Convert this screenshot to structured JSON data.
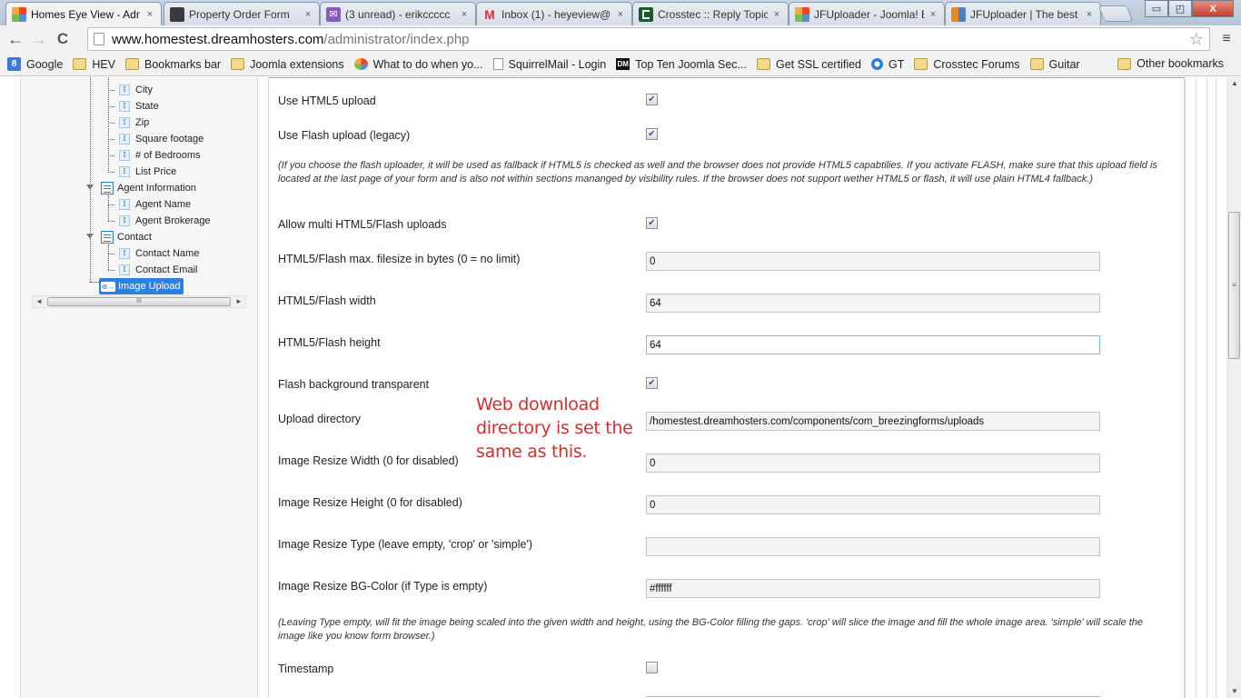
{
  "browser": {
    "tabs": [
      {
        "title": "Homes Eye View - Adr",
        "icon": "joomla-icon",
        "active": true
      },
      {
        "title": "Property Order Form",
        "icon": "joomla-dark-icon",
        "active": false
      },
      {
        "title": "(3 unread) - erikccccc",
        "icon": "mail-icon",
        "active": false
      },
      {
        "title": "Inbox (1) - heyeview@",
        "icon": "gmail-icon",
        "active": false
      },
      {
        "title": "Crosstec :: Reply Topic",
        "icon": "crosstec-icon",
        "active": false
      },
      {
        "title": "JFUploader - Joomla! E",
        "icon": "joomla-icon",
        "active": false
      },
      {
        "title": "JFUploader | The best",
        "icon": "jfuploader-icon",
        "active": false
      }
    ],
    "close_glyph": "×",
    "window_controls": {
      "minimize": "▭",
      "maximize": "◰",
      "close": "X"
    },
    "nav": {
      "back": "←",
      "forward": "→",
      "reload": "C"
    },
    "url": {
      "host": "www.homestest.dreamhosters.com",
      "path": "/administrator/index.php"
    },
    "star_glyph": "☆",
    "menu_glyph": "≡",
    "bookmarks": [
      {
        "label": "Google",
        "icon": "google-icon",
        "glyph": "8"
      },
      {
        "label": "HEV",
        "icon": "folder-icon",
        "glyph": ""
      },
      {
        "label": "Bookmarks bar",
        "icon": "folder-icon",
        "glyph": ""
      },
      {
        "label": "Joomla extensions",
        "icon": "folder-icon",
        "glyph": ""
      },
      {
        "label": "What to do when yo...",
        "icon": "joomla-icon",
        "glyph": ""
      },
      {
        "label": "SquirrelMail - Login",
        "icon": "doc-icon",
        "glyph": ""
      },
      {
        "label": "Top Ten Joomla Sec...",
        "icon": "dm-icon",
        "glyph": "DM"
      },
      {
        "label": "Get SSL certified",
        "icon": "folder-icon",
        "glyph": ""
      },
      {
        "label": "GT",
        "icon": "gt-icon",
        "glyph": ""
      },
      {
        "label": "Crosstec Forums",
        "icon": "folder-icon",
        "glyph": ""
      },
      {
        "label": "Guitar",
        "icon": "folder-icon",
        "glyph": ""
      }
    ],
    "other_bookmarks": "Other bookmarks"
  },
  "tree": {
    "items": [
      {
        "label": "City",
        "type": "field"
      },
      {
        "label": "State",
        "type": "field"
      },
      {
        "label": "Zip",
        "type": "field"
      },
      {
        "label": "Square footage",
        "type": "field"
      },
      {
        "label": "# of Bedrooms",
        "type": "field"
      },
      {
        "label": "List Price",
        "type": "field"
      },
      {
        "label": "Agent Information",
        "type": "section"
      },
      {
        "label": "Agent Name",
        "type": "field"
      },
      {
        "label": "Agent Brokerage",
        "type": "field"
      },
      {
        "label": "Contact",
        "type": "section"
      },
      {
        "label": "Contact Name",
        "type": "field"
      },
      {
        "label": "Contact Email",
        "type": "field"
      },
      {
        "label": "Image Upload",
        "type": "upload",
        "selected": true
      }
    ],
    "field_glyph": "I",
    "upload_glyph": "⊕→",
    "scroll": {
      "left": "◄",
      "right": "►",
      "thumb": "III"
    }
  },
  "form": {
    "use_html5_upload": {
      "label": "Use HTML5 upload",
      "checked": true
    },
    "use_flash_upload": {
      "label": "Use Flash upload (legacy)",
      "checked": true
    },
    "flash_help": "(If you choose the flash uploader, it will be used as fallback if HTML5 is checked as well and the browser does not provide HTML5 capabtilies. If you activate FLASH, make sure that this upload field is located at the last page of your form and is also not within sections mananged by visibility rules. If the browser does not support wether HTML5 or flash, it will use plain HTML4 fallback.)",
    "allow_multi": {
      "label": "Allow multi HTML5/Flash uploads",
      "checked": true
    },
    "max_filesize": {
      "label": "HTML5/Flash max. filesize in bytes (0 = no limit)",
      "value": "0"
    },
    "flash_width": {
      "label": "HTML5/Flash width",
      "value": "64"
    },
    "flash_height": {
      "label": "HTML5/Flash height",
      "value": "64"
    },
    "flash_transparent": {
      "label": "Flash background transparent",
      "checked": true
    },
    "upload_directory": {
      "label": "Upload directory",
      "value": "/homestest.dreamhosters.com/components/com_breezingforms/uploads"
    },
    "resize_width": {
      "label": "Image Resize Width (0 for disabled)",
      "value": "0"
    },
    "resize_height": {
      "label": "Image Resize Height (0 for disabled)",
      "value": "0"
    },
    "resize_type": {
      "label": "Image Resize Type (leave empty, 'crop' or 'simple')",
      "value": ""
    },
    "resize_bgcolor": {
      "label": "Image Resize BG-Color (if Type is empty)",
      "value": "#ffffff"
    },
    "resize_help": "(Leaving Type empty, will fit the image being scaled into the given width and height, using the BG-Color filling the gaps. 'crop' will slice the image and fill the whole image area. 'simple' will scale the image like you know form browser.)",
    "timestamp": {
      "label": "Timestamp",
      "checked": false
    },
    "check_glyph": "✔"
  },
  "annotation": {
    "text": "Web download directory is set the same as this.",
    "color": "#d12e2e"
  },
  "page_scroll": {
    "up": "▲",
    "down": "▼",
    "thumb": "≡"
  }
}
